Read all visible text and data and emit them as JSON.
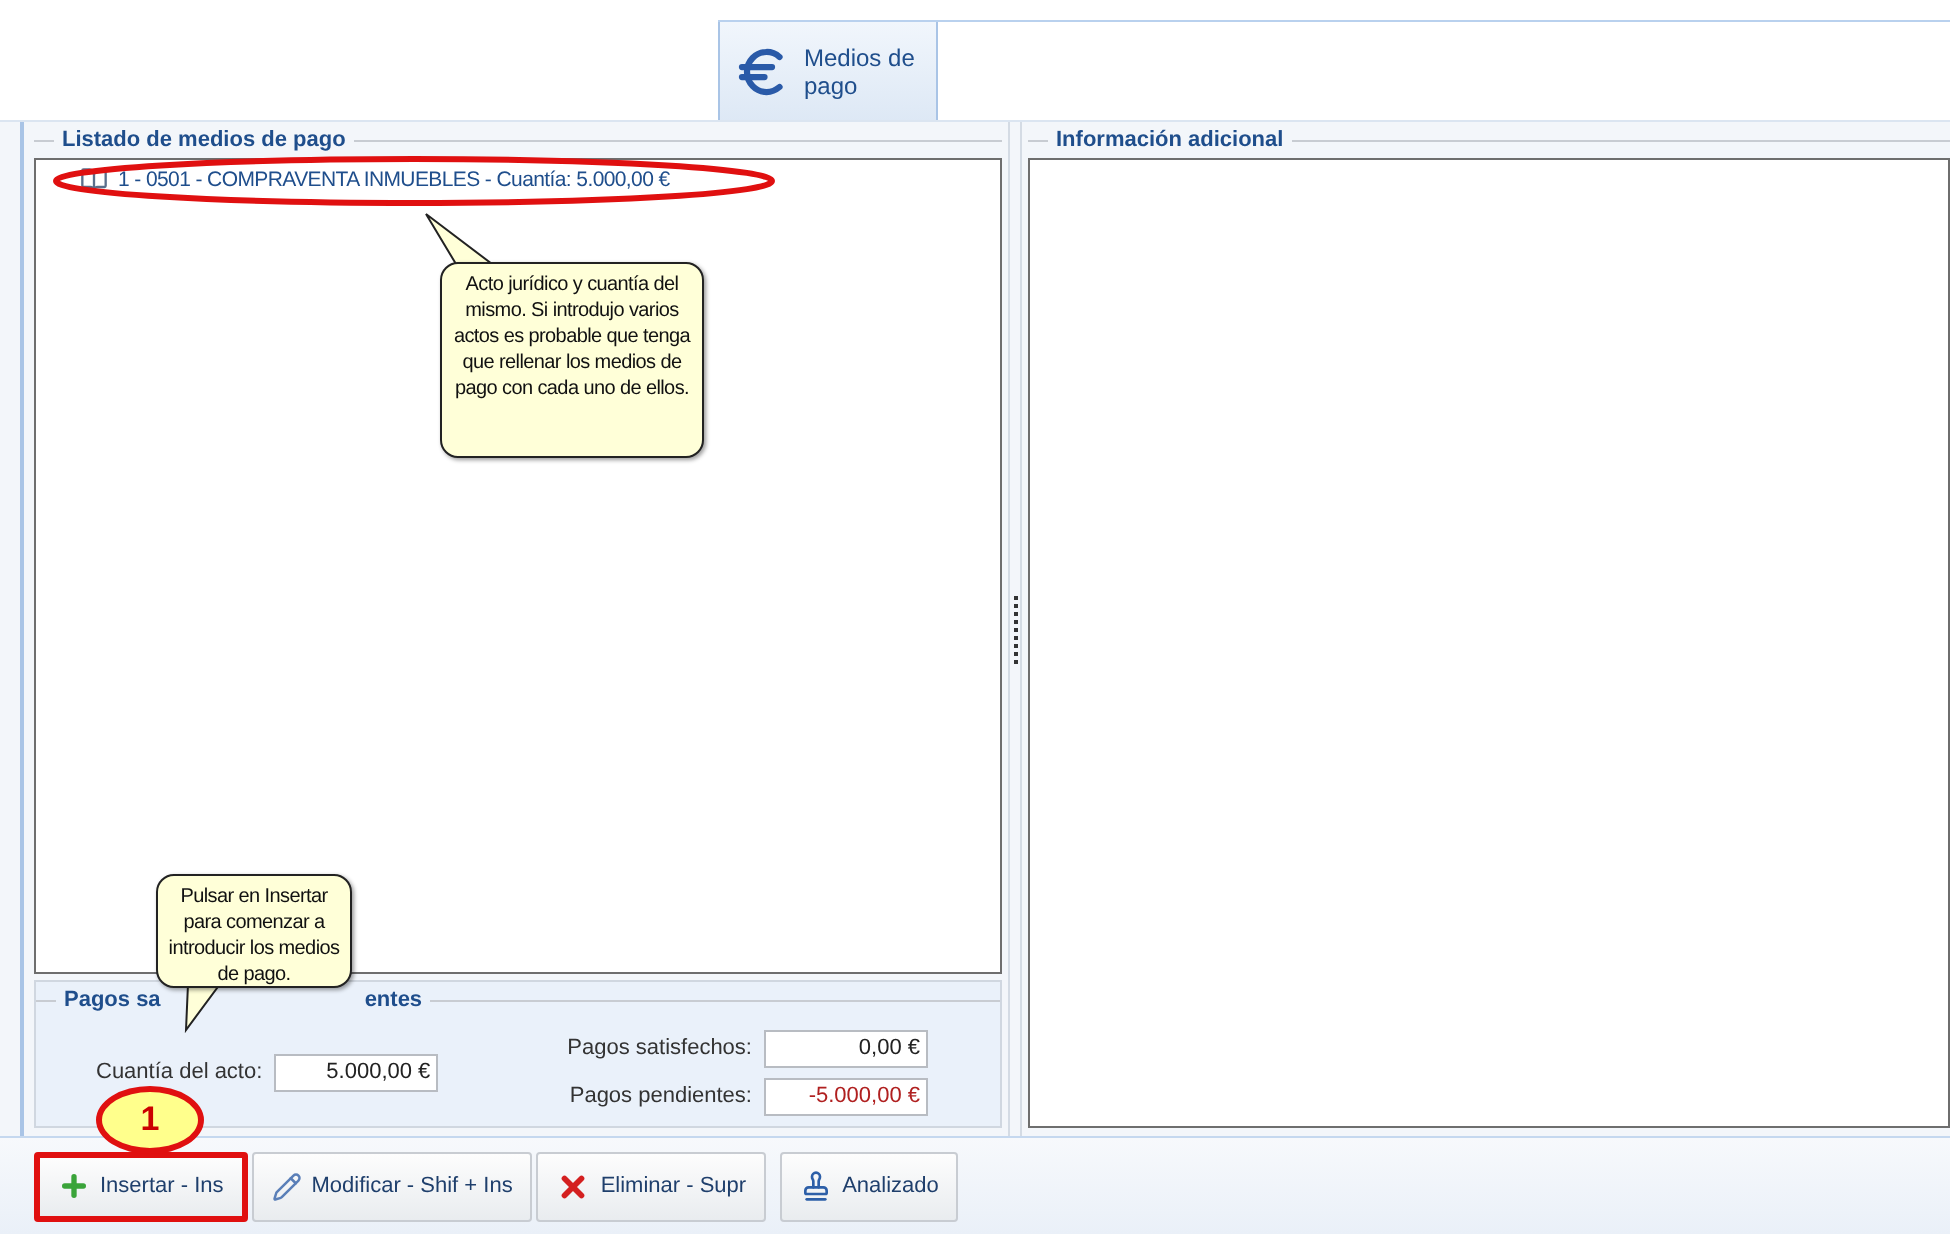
{
  "tabs": [
    {
      "label": "Medios de pago",
      "selected": true
    }
  ],
  "list_panel": {
    "title": "Listado de medios de pago",
    "items": [
      {
        "text": "1 - 0501 - COMPRAVENTA INMUEBLES - Cuantía: 5.000,00 €"
      }
    ]
  },
  "totals": {
    "legend_parts": [
      "Pagos sa",
      "entes"
    ],
    "fields": [
      {
        "label": "Cuantía del acto:",
        "value": "5.000,00 €",
        "negative": false
      },
      {
        "label": "Pagos satisfechos:",
        "value": "0,00 €",
        "negative": false
      },
      {
        "label": "Pagos pendientes:",
        "value": "-5.000,00 €",
        "negative": true
      }
    ]
  },
  "info_panel": {
    "title": "Información adicional"
  },
  "buttons": [
    {
      "label": "Insertar - Ins",
      "kind": "insert",
      "highlighted": true
    },
    {
      "label": "Modificar - Shif + Ins",
      "kind": "modify",
      "highlighted": false
    },
    {
      "label": "Eliminar - Supr",
      "kind": "delete",
      "highlighted": false
    },
    {
      "label": "Analizado",
      "kind": "analyze",
      "highlighted": false
    }
  ],
  "callouts": [
    {
      "text": "Acto jurídico y cuantía del mismo. Si introdujo varios actos es probable que tenga que rellenar los medios de pago con cada uno de ellos."
    },
    {
      "text": "Pulsar en Insertar para comenzar a introducir los medios de pago."
    }
  ],
  "step_badge": {
    "text": "1"
  }
}
